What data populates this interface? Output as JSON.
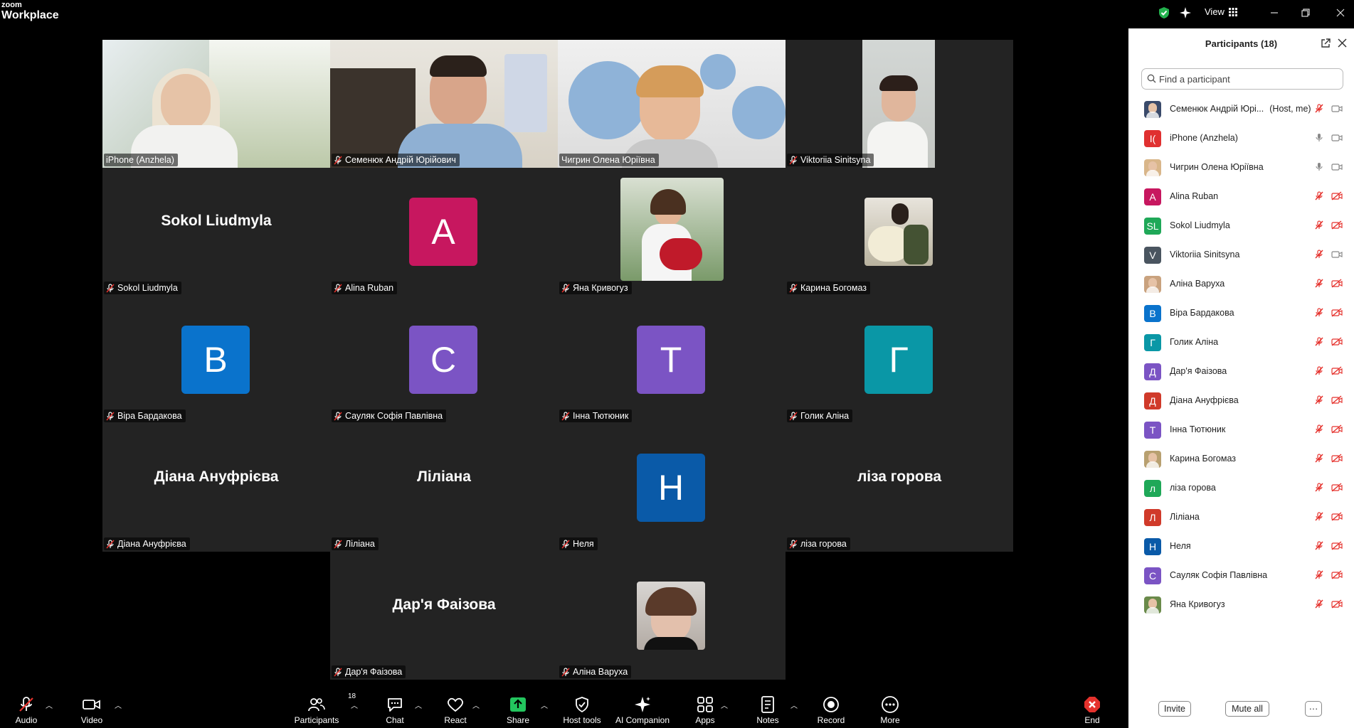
{
  "app": {
    "brand_line1": "zoom",
    "brand_line2": "Workplace",
    "view_label": "View"
  },
  "gallery": {
    "tiles": [
      {
        "name": "iPhone (Anzhela)",
        "kind": "video",
        "mic_off": false
      },
      {
        "name": "Семенюк Андрій Юрійович",
        "kind": "video",
        "mic_off": true
      },
      {
        "name": "Чигрин Олена Юріївна",
        "kind": "video",
        "mic_off": false,
        "active": true
      },
      {
        "name": "Viktoriia Sinitsyna",
        "kind": "video",
        "mic_off": true
      },
      {
        "name": "Sokol Liudmyla",
        "kind": "name",
        "big": "Sokol Liudmyla",
        "mic_off": true
      },
      {
        "name": "Alina Ruban",
        "kind": "letter",
        "letter": "A",
        "color": "#c7175f",
        "mic_off": true
      },
      {
        "name": "Яна Кривогуз",
        "kind": "photo",
        "mic_off": true
      },
      {
        "name": "Карина Богомаз",
        "kind": "photo",
        "mic_off": true
      },
      {
        "name": "Віра Бардакова",
        "kind": "letter",
        "letter": "B",
        "color": "#0a73cc",
        "mic_off": true
      },
      {
        "name": "Сауляк Софія Павлівна",
        "kind": "letter",
        "letter": "C",
        "color": "#7b54c4",
        "mic_off": true
      },
      {
        "name": "Інна Тютюник",
        "kind": "letter",
        "letter": "T",
        "color": "#7b54c4",
        "mic_off": true
      },
      {
        "name": "Голик Аліна",
        "kind": "letter",
        "letter": "Г",
        "color": "#0a97a6",
        "mic_off": true
      },
      {
        "name": "Діана Ануфрієва",
        "kind": "name",
        "big": "Діана Ануфрієва",
        "mic_off": true
      },
      {
        "name": "Ліліана",
        "kind": "name",
        "big": "Ліліана",
        "mic_off": true
      },
      {
        "name": "Неля",
        "kind": "letter",
        "letter": "H",
        "color": "#0a5aa8",
        "mic_off": true
      },
      {
        "name": "ліза горова",
        "kind": "name",
        "big": "ліза горова",
        "mic_off": true
      },
      {
        "name": "Дар'я Фаізова",
        "kind": "name",
        "big": "Дар'я Фаізова",
        "mic_off": true
      },
      {
        "name": "Аліна Варуха",
        "kind": "photo",
        "mic_off": true
      }
    ]
  },
  "toolbar": {
    "audio": "Audio",
    "video": "Video",
    "participants": "Participants",
    "participants_count": "18",
    "chat": "Chat",
    "react": "React",
    "share": "Share",
    "host_tools": "Host tools",
    "ai_companion": "AI Companion",
    "apps": "Apps",
    "notes": "Notes",
    "record": "Record",
    "more": "More",
    "end": "End"
  },
  "panel": {
    "title": "Participants (18)",
    "search_placeholder": "Find a participant",
    "participants": [
      {
        "name": "Семенюк Андрій Юрі...",
        "role": "(Host, me)",
        "avatar": "photo",
        "color": "#3a4a6a",
        "mic": "off",
        "cam": "on"
      },
      {
        "name": "iPhone (Anzhela)",
        "avatar": "I(",
        "color": "#e03030",
        "mic": "on",
        "cam": "on"
      },
      {
        "name": "Чигрин Олена Юріївна",
        "avatar": "photo",
        "color": "#d9b68a",
        "mic": "on",
        "cam": "on"
      },
      {
        "name": "Alina Ruban",
        "avatar": "A",
        "color": "#c7175f",
        "mic": "off",
        "cam": "off"
      },
      {
        "name": "Sokol Liudmyla",
        "avatar": "SL",
        "color": "#1fa858",
        "mic": "off",
        "cam": "off"
      },
      {
        "name": "Viktoriia Sinitsyna",
        "avatar": "V",
        "color": "#4a5560",
        "mic": "off",
        "cam": "on"
      },
      {
        "name": "Аліна Варуха",
        "avatar": "photo",
        "color": "#c9a27e",
        "mic": "off",
        "cam": "off"
      },
      {
        "name": "Віра Бардакова",
        "avatar": "B",
        "color": "#0a73cc",
        "mic": "off",
        "cam": "off"
      },
      {
        "name": "Голик Аліна",
        "avatar": "Г",
        "color": "#0a97a6",
        "mic": "off",
        "cam": "off"
      },
      {
        "name": "Дар'я Фаізова",
        "avatar": "Д",
        "color": "#7b54c4",
        "mic": "off",
        "cam": "off"
      },
      {
        "name": "Діана Ануфрієва",
        "avatar": "Д",
        "color": "#d03a2a",
        "mic": "off",
        "cam": "off"
      },
      {
        "name": "Інна Тютюник",
        "avatar": "T",
        "color": "#7b54c4",
        "mic": "off",
        "cam": "off"
      },
      {
        "name": "Карина Богомаз",
        "avatar": "photo",
        "color": "#b8a070",
        "mic": "off",
        "cam": "off"
      },
      {
        "name": "ліза горова",
        "avatar": "л",
        "color": "#1fa858",
        "mic": "off",
        "cam": "off"
      },
      {
        "name": "Ліліана",
        "avatar": "Л",
        "color": "#d03a2a",
        "mic": "off",
        "cam": "off"
      },
      {
        "name": "Неля",
        "avatar": "H",
        "color": "#0a5aa8",
        "mic": "off",
        "cam": "off"
      },
      {
        "name": "Сауляк Софія Павлівна",
        "avatar": "C",
        "color": "#7b54c4",
        "mic": "off",
        "cam": "off"
      },
      {
        "name": "Яна Кривогуз",
        "avatar": "photo",
        "color": "#6a8a4a",
        "mic": "off",
        "cam": "off"
      }
    ],
    "invite": "Invite",
    "mute_all": "Mute all"
  }
}
